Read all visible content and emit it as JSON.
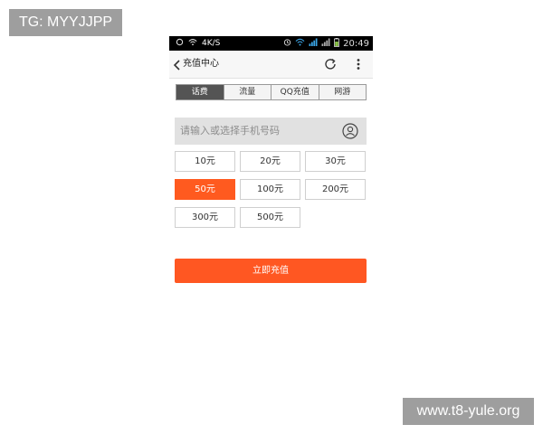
{
  "watermarks": {
    "top": "TG: MYYJJPP",
    "bottom": "www.t8-yule.org"
  },
  "status_bar": {
    "network": "4K/S",
    "time": "20:49"
  },
  "app_bar": {
    "title": "充值中心",
    "back_icon": "chevron-left-icon",
    "refresh_icon": "refresh-icon",
    "more_icon": "more-vertical-icon"
  },
  "tabs": [
    {
      "label": "话费",
      "active": true
    },
    {
      "label": "流量",
      "active": false
    },
    {
      "label": "QQ充值",
      "active": false
    },
    {
      "label": "网游",
      "active": false
    }
  ],
  "phone_input": {
    "placeholder": "请输入或选择手机号码",
    "contact_icon": "contact-icon"
  },
  "amounts": [
    {
      "label": "10元",
      "selected": false
    },
    {
      "label": "20元",
      "selected": false
    },
    {
      "label": "30元",
      "selected": false
    },
    {
      "label": "50元",
      "selected": true
    },
    {
      "label": "100元",
      "selected": false
    },
    {
      "label": "200元",
      "selected": false
    },
    {
      "label": "300元",
      "selected": false
    },
    {
      "label": "500元",
      "selected": false
    }
  ],
  "submit": {
    "label": "立即充值"
  },
  "colors": {
    "accent": "#ff5722",
    "tab_active": "#545454"
  }
}
